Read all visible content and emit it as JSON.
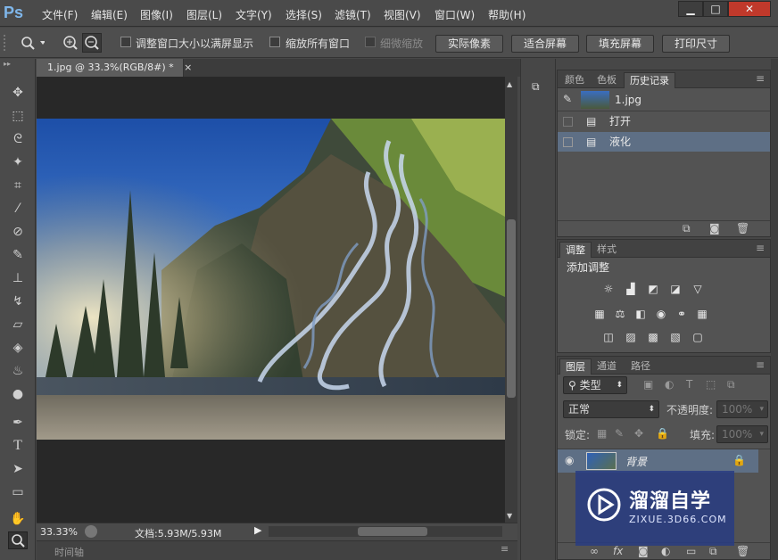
{
  "app": {
    "logo": "Ps"
  },
  "menu": [
    "文件(F)",
    "编辑(E)",
    "图像(I)",
    "图层(L)",
    "文字(Y)",
    "选择(S)",
    "滤镜(T)",
    "视图(V)",
    "窗口(W)",
    "帮助(H)"
  ],
  "window_controls": {
    "minimize": "▁",
    "maximize": "□",
    "close": "✕"
  },
  "options": {
    "resize_windows": "调整窗口大小以满屏显示",
    "zoom_all": "缩放所有窗口",
    "scrubby_zoom": "细微缩放",
    "actual_pixels": "实际像素",
    "fit_screen": "适合屏幕",
    "fill_screen": "填充屏幕",
    "print_size": "打印尺寸"
  },
  "document": {
    "tab_title": "1.jpg @ 33.3%(RGB/8#) *",
    "close": "×"
  },
  "status": {
    "zoom": "33.33%",
    "doc_size": "文档:5.93M/5.93M"
  },
  "timeline": {
    "label": "时间轴"
  },
  "history_panel": {
    "tabs": [
      "颜色",
      "色板",
      "历史记录"
    ],
    "snapshot": "1.jpg",
    "items": [
      "打开",
      "液化"
    ]
  },
  "adjust_panel": {
    "tabs": [
      "调整",
      "样式"
    ],
    "title": "添加调整"
  },
  "layers_panel": {
    "tabs": [
      "图层",
      "通道",
      "路径"
    ],
    "filter": "类型",
    "blend_mode": "正常",
    "opacity_label": "不透明度:",
    "opacity_value": "100%",
    "lock_label": "锁定:",
    "fill_label": "填充:",
    "fill_value": "100%",
    "layer_name": "背景"
  },
  "watermark": {
    "brand": "溜溜自学",
    "url": "ZIXUE.3D66.COM"
  },
  "colors": {
    "accent": "#7fb6ea",
    "selected_row": "#5e6f85",
    "canvas": "#282828"
  }
}
